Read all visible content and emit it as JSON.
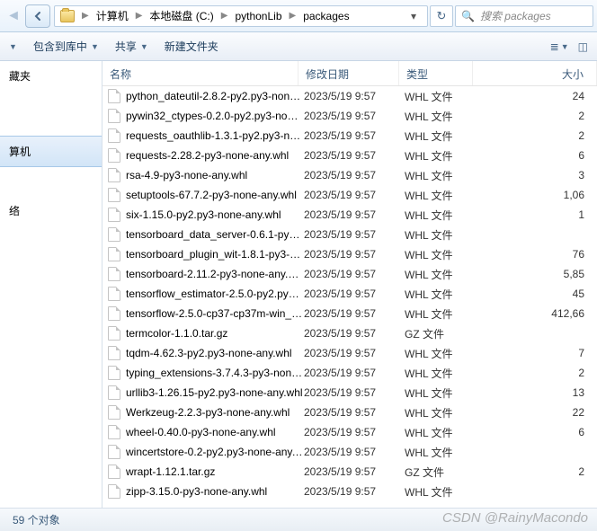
{
  "breadcrumbs": [
    "计算机",
    "本地磁盘 (C:)",
    "pythonLib",
    "packages"
  ],
  "search": {
    "placeholder": "搜索 packages"
  },
  "toolbar": {
    "include": "包含到库中",
    "share": "共享",
    "newfolder": "新建文件夹"
  },
  "sidebar": {
    "items": [
      {
        "label": "藏夹"
      },
      {
        "label": "算机",
        "selected": true
      },
      {
        "label": "络"
      }
    ]
  },
  "columns": {
    "name": "名称",
    "date": "修改日期",
    "type": "类型",
    "size": "大小"
  },
  "files": [
    {
      "name": "python_dateutil-2.8.2-py2.py3-none-a...",
      "date": "2023/5/19 9:57",
      "type": "WHL 文件",
      "size": "24"
    },
    {
      "name": "pywin32_ctypes-0.2.0-py2.py3-none-a...",
      "date": "2023/5/19 9:57",
      "type": "WHL 文件",
      "size": "2"
    },
    {
      "name": "requests_oauthlib-1.3.1-py2.py3-non...",
      "date": "2023/5/19 9:57",
      "type": "WHL 文件",
      "size": "2"
    },
    {
      "name": "requests-2.28.2-py3-none-any.whl",
      "date": "2023/5/19 9:57",
      "type": "WHL 文件",
      "size": "6"
    },
    {
      "name": "rsa-4.9-py3-none-any.whl",
      "date": "2023/5/19 9:57",
      "type": "WHL 文件",
      "size": "3"
    },
    {
      "name": "setuptools-67.7.2-py3-none-any.whl",
      "date": "2023/5/19 9:57",
      "type": "WHL 文件",
      "size": "1,06"
    },
    {
      "name": "six-1.15.0-py2.py3-none-any.whl",
      "date": "2023/5/19 9:57",
      "type": "WHL 文件",
      "size": "1"
    },
    {
      "name": "tensorboard_data_server-0.6.1-py3-n...",
      "date": "2023/5/19 9:57",
      "type": "WHL 文件",
      "size": ""
    },
    {
      "name": "tensorboard_plugin_wit-1.8.1-py3-no...",
      "date": "2023/5/19 9:57",
      "type": "WHL 文件",
      "size": "76"
    },
    {
      "name": "tensorboard-2.11.2-py3-none-any.whl",
      "date": "2023/5/19 9:57",
      "type": "WHL 文件",
      "size": "5,85"
    },
    {
      "name": "tensorflow_estimator-2.5.0-py2.py3-n...",
      "date": "2023/5/19 9:57",
      "type": "WHL 文件",
      "size": "45"
    },
    {
      "name": "tensorflow-2.5.0-cp37-cp37m-win_am...",
      "date": "2023/5/19 9:57",
      "type": "WHL 文件",
      "size": "412,66"
    },
    {
      "name": "termcolor-1.1.0.tar.gz",
      "date": "2023/5/19 9:57",
      "type": "GZ 文件",
      "size": ""
    },
    {
      "name": "tqdm-4.62.3-py2.py3-none-any.whl",
      "date": "2023/5/19 9:57",
      "type": "WHL 文件",
      "size": "7"
    },
    {
      "name": "typing_extensions-3.7.4.3-py3-none-a...",
      "date": "2023/5/19 9:57",
      "type": "WHL 文件",
      "size": "2"
    },
    {
      "name": "urllib3-1.26.15-py2.py3-none-any.whl",
      "date": "2023/5/19 9:57",
      "type": "WHL 文件",
      "size": "13"
    },
    {
      "name": "Werkzeug-2.2.3-py3-none-any.whl",
      "date": "2023/5/19 9:57",
      "type": "WHL 文件",
      "size": "22"
    },
    {
      "name": "wheel-0.40.0-py3-none-any.whl",
      "date": "2023/5/19 9:57",
      "type": "WHL 文件",
      "size": "6"
    },
    {
      "name": "wincertstore-0.2-py2.py3-none-any.whl",
      "date": "2023/5/19 9:57",
      "type": "WHL 文件",
      "size": ""
    },
    {
      "name": "wrapt-1.12.1.tar.gz",
      "date": "2023/5/19 9:57",
      "type": "GZ 文件",
      "size": "2"
    },
    {
      "name": "zipp-3.15.0-py3-none-any.whl",
      "date": "2023/5/19 9:57",
      "type": "WHL 文件",
      "size": ""
    }
  ],
  "status": "59 个对象",
  "watermark": "CSDN @RainyMacondo"
}
